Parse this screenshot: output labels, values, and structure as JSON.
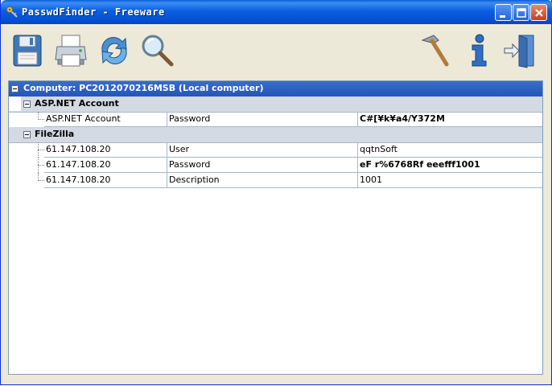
{
  "window": {
    "title": "PasswdFinder - Freeware",
    "controls": [
      "minimize-icon",
      "maximize-icon",
      "close-icon"
    ]
  },
  "toolbar": {
    "left_tools": [
      {
        "name": "save",
        "icon": "floppy-disk-icon"
      },
      {
        "name": "print",
        "icon": "printer-icon"
      },
      {
        "name": "refresh",
        "icon": "refresh-arrows-icon"
      },
      {
        "name": "search",
        "icon": "magnifier-icon"
      }
    ],
    "right_tools": [
      {
        "name": "settings",
        "icon": "hammer-icon"
      },
      {
        "name": "about",
        "icon": "info-icon"
      },
      {
        "name": "exit",
        "icon": "exit-door-icon"
      }
    ]
  },
  "tree": {
    "root_label": "Computer: PC2012070216MSB (Local computer)",
    "groups": [
      {
        "label": "ASP.NET Account",
        "rows": [
          {
            "host": "ASP.NET Account",
            "field": "Password",
            "value": "C#[¥k¥a4/Y372M",
            "bold": true
          }
        ]
      },
      {
        "label": "FileZilla",
        "rows": [
          {
            "host": "61.147.108.20",
            "field": "User",
            "value": "qqtnSoft",
            "bold": false
          },
          {
            "host": "61.147.108.20",
            "field": "Password",
            "value": "eF r%6768Rf eeefff1001",
            "bold": true
          },
          {
            "host": "61.147.108.20",
            "field": "Description",
            "value": "1001",
            "bold": false
          }
        ]
      }
    ]
  },
  "colors": {
    "titlebar": "#0b5ee0",
    "root_row": "#2d60c0",
    "group_row": "#d4dae3",
    "grid_line": "#a9b7c6",
    "window_bg": "#ece9d8"
  }
}
